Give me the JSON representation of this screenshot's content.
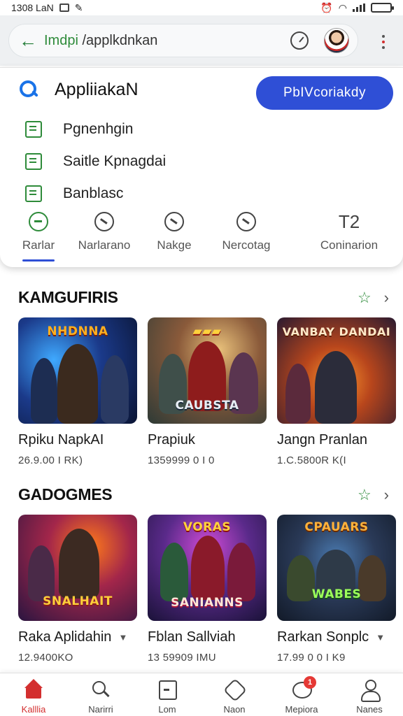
{
  "status_bar": {
    "time_text": "1308 LaN",
    "icons": [
      "image-icon",
      "mute-icon",
      "alarm-icon",
      "wifi-icon",
      "signal-icon",
      "battery-icon"
    ],
    "battery_level": 0.8
  },
  "address_bar": {
    "domain": "Imdpi",
    "path": " /applkdnkan"
  },
  "search_panel": {
    "query": "AppliiakaN",
    "primary_button": "PbIVcoriakdy",
    "suggestions": [
      {
        "label": "Pgnenhgin",
        "icon": "bookmark-icon"
      },
      {
        "label": "Saitle Kpnagdai",
        "icon": "list-icon"
      },
      {
        "label": "Banblasc",
        "icon": "image-icon"
      }
    ],
    "tabs": [
      {
        "label": "Rarlar",
        "icon": "compass-icon",
        "active": true
      },
      {
        "label": "Narlarano",
        "icon": "clock-icon"
      },
      {
        "label": "Nakge",
        "icon": "bolt-icon"
      },
      {
        "label": "Nercotag",
        "icon": "chat-icon"
      },
      {
        "label": "Coninarion",
        "number": "T2"
      }
    ]
  },
  "sections": [
    {
      "title": "KAMGUFIRIS",
      "items": [
        {
          "name": "Rpiku NapkAI",
          "stat": "26.9.00 I RK)",
          "art_title": "NHDNNA"
        },
        {
          "name": "Prapiuk",
          "stat": "1359999 0 I 0",
          "art_title": "CAUBSTA"
        },
        {
          "name": "Jangn Pranlan",
          "stat": "1.C.5800R K(I",
          "art_title": "VANBAY DANDAI"
        }
      ]
    },
    {
      "title": "GADOGMES",
      "items": [
        {
          "name": "Raka Aplidahin",
          "stat": "12.9400KO",
          "art_title": "SNALHAIT"
        },
        {
          "name": "Fblan Sallviah",
          "stat": "13 59909 IMU",
          "art_title": "SANIANNS"
        },
        {
          "name": "Rarkan Sonplc",
          "stat": "17.99 0 0 I K9",
          "art_title": "CPAUARS"
        }
      ]
    }
  ],
  "bottom_nav": [
    {
      "label": "Kalllia",
      "icon": "home-icon",
      "active": true
    },
    {
      "label": "Narirri",
      "icon": "search-icon"
    },
    {
      "label": "Lom",
      "icon": "apps-icon"
    },
    {
      "label": "Naon",
      "icon": "puzzle-icon"
    },
    {
      "label": "Mepiora",
      "icon": "notifications-icon",
      "badge": "1"
    },
    {
      "label": "Nanes",
      "icon": "user-icon"
    }
  ],
  "colors": {
    "accent": "#2f4fd6",
    "green": "#2e8b3a",
    "red": "#d32f2f"
  }
}
